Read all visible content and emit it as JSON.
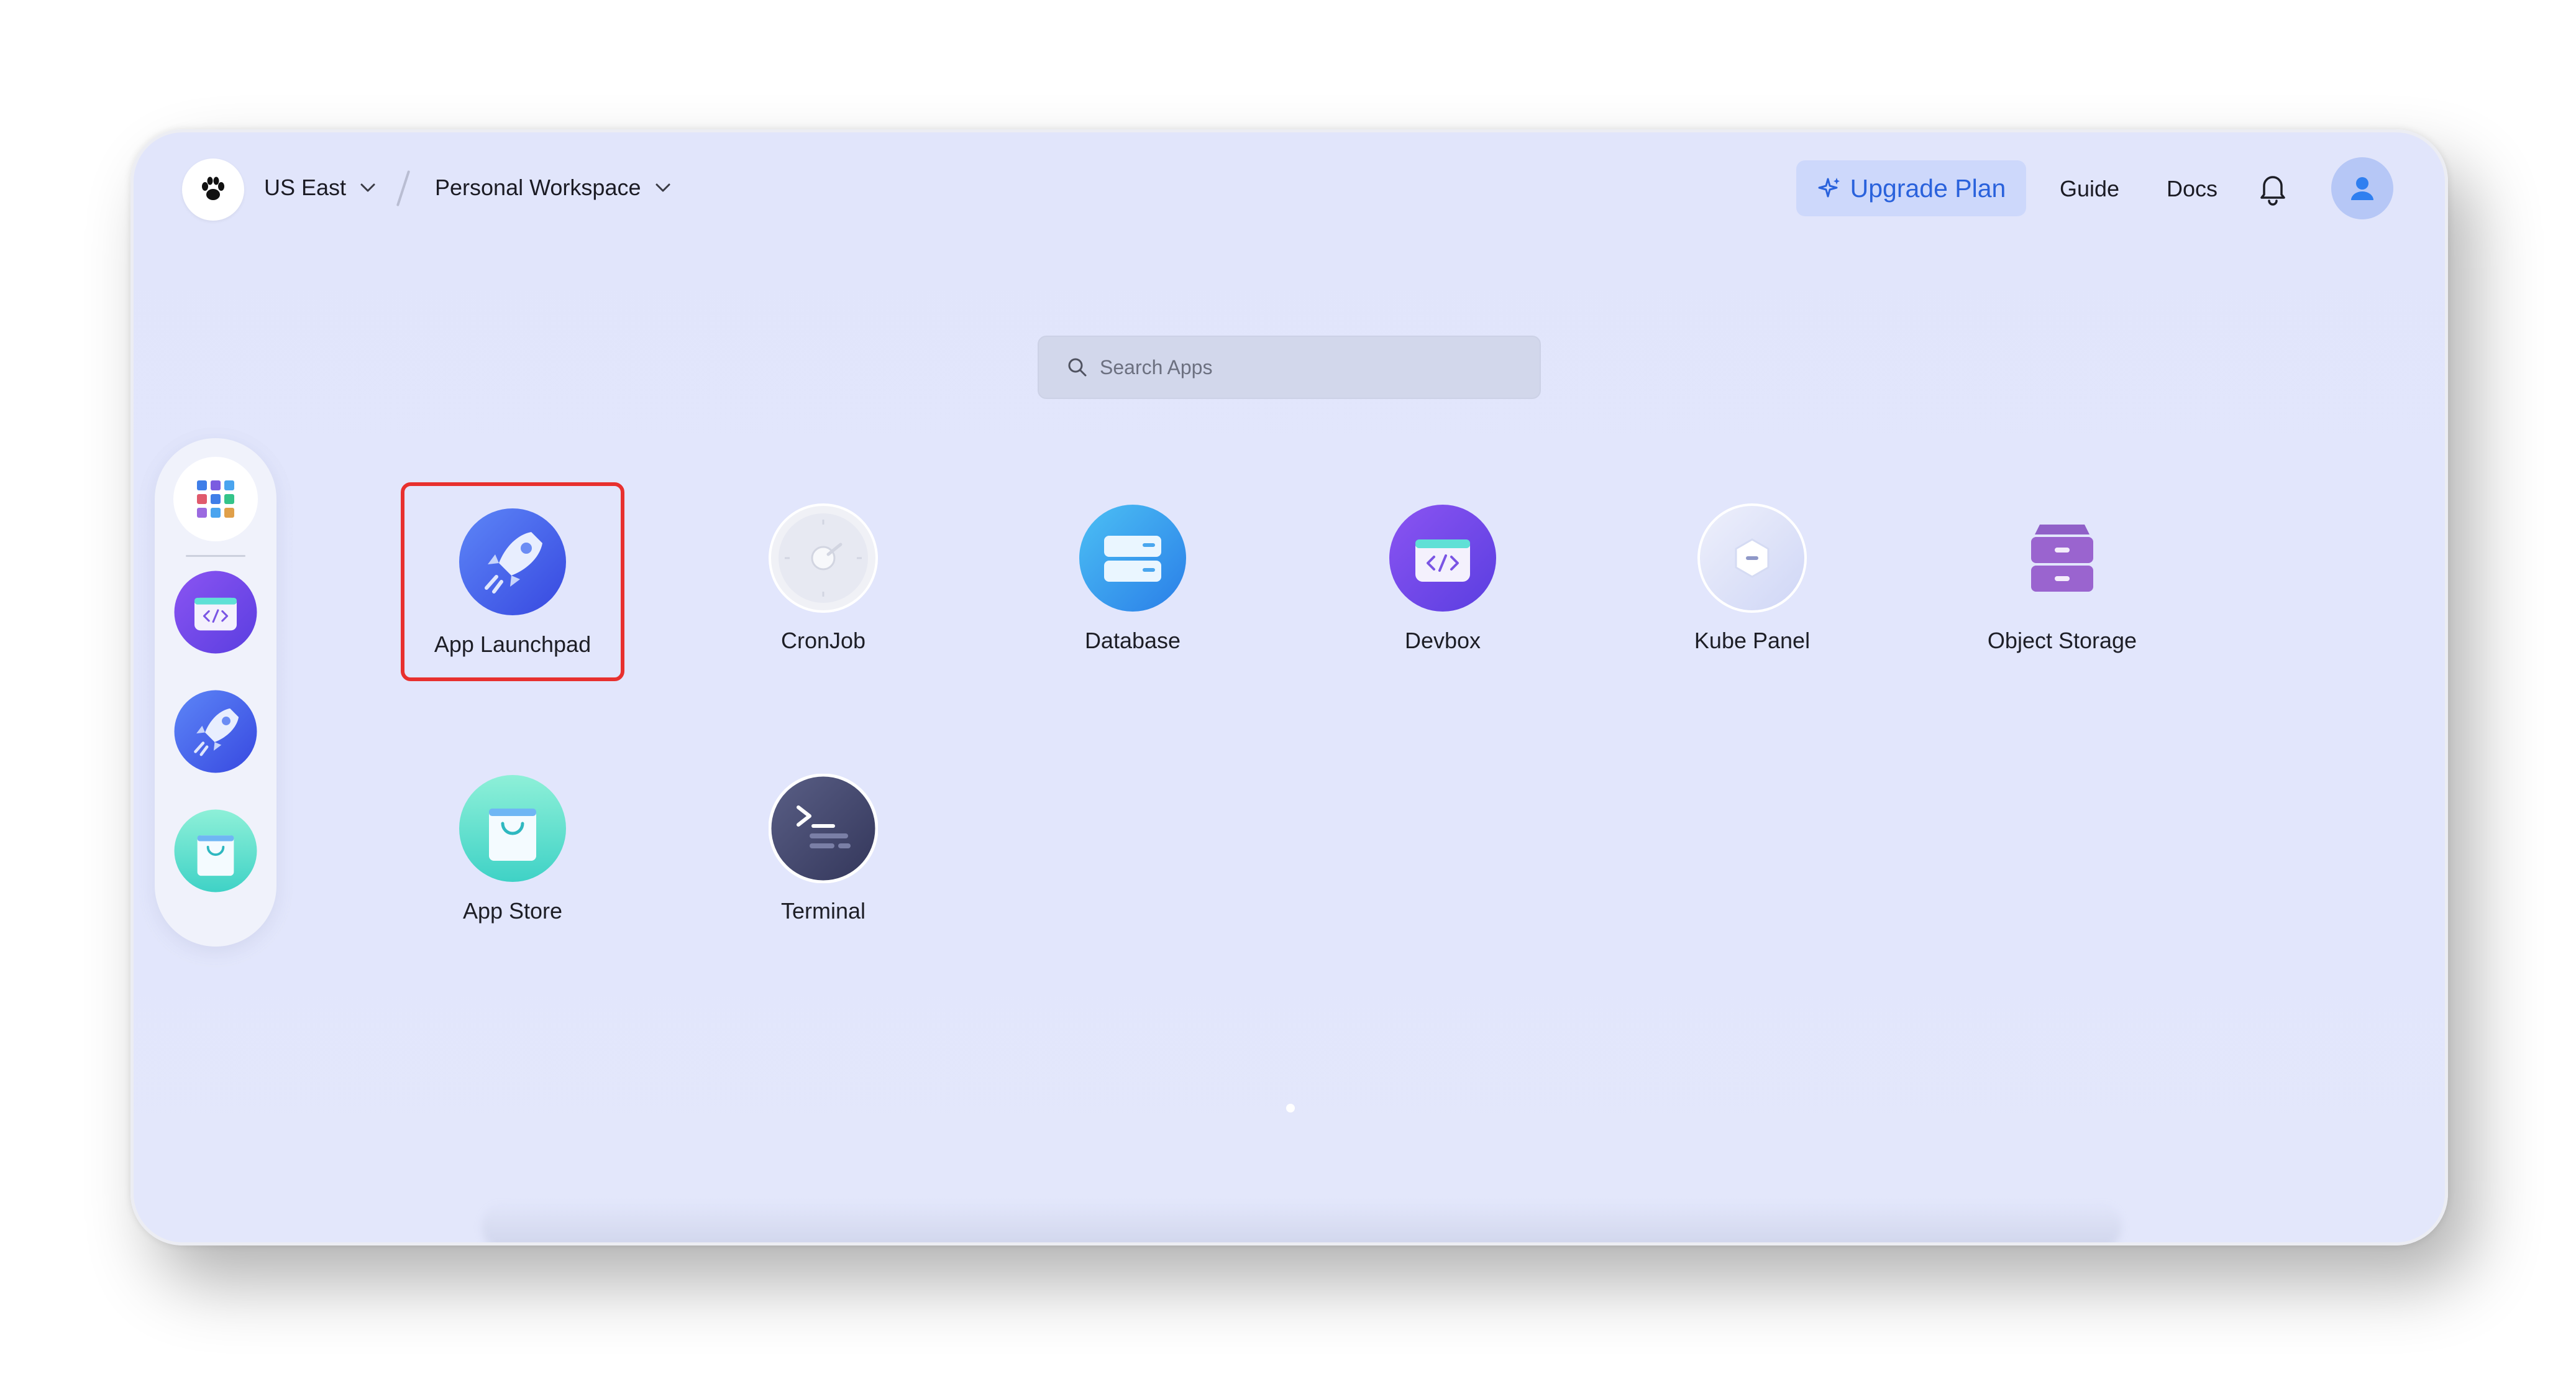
{
  "header": {
    "region": "US East",
    "workspace": "Personal Workspace",
    "upgrade_label": "Upgrade Plan",
    "guide_label": "Guide",
    "docs_label": "Docs"
  },
  "search": {
    "placeholder": "Search Apps",
    "value": ""
  },
  "dock": {
    "items": [
      "apps-grid-icon",
      "devbox-icon",
      "app-launchpad-icon",
      "app-store-icon"
    ]
  },
  "apps": [
    {
      "label": "App Launchpad",
      "selected": true
    },
    {
      "label": "CronJob"
    },
    {
      "label": "Database"
    },
    {
      "label": "Devbox"
    },
    {
      "label": "Kube Panel"
    },
    {
      "label": "Object Storage"
    },
    {
      "label": "App Store"
    },
    {
      "label": "Terminal"
    }
  ],
  "colors": {
    "accent": "#2a62dc",
    "selection": "#e8302e",
    "background": "#e1e5fb"
  }
}
